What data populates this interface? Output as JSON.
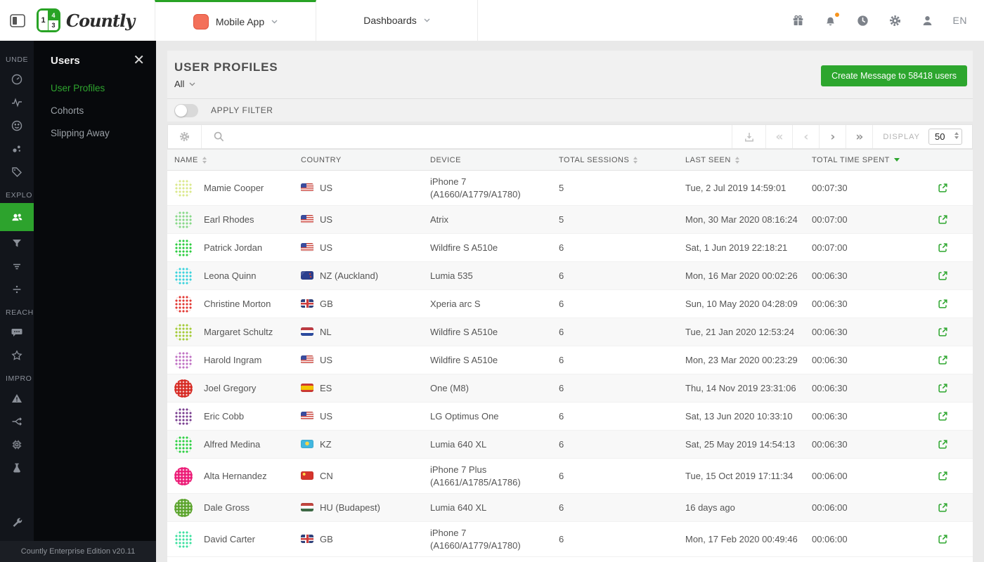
{
  "header": {
    "logo_text": "Countly",
    "app_selector_label": "Mobile App",
    "dashboards_label": "Dashboards",
    "language": "EN",
    "right_icons": [
      "gift-icon",
      "bell-icon",
      "clock-icon",
      "gear-icon",
      "user-icon"
    ],
    "bell_badge_color": "#f7941d",
    "accent_green": "#2da62e",
    "app_icon_color": "#f3705a"
  },
  "sidebar": {
    "sections": [
      {
        "label": "UNDE"
      },
      {
        "label": "EXPLO"
      },
      {
        "label": "REACH"
      },
      {
        "label": "IMPRO"
      }
    ],
    "footer": "Countly Enterprise Edition v20.11"
  },
  "flyout": {
    "title": "Users",
    "items": [
      {
        "label": "User Profiles",
        "active": true
      },
      {
        "label": "Cohorts",
        "active": false
      },
      {
        "label": "Slipping Away",
        "active": false
      }
    ]
  },
  "main": {
    "title": "USER PROFILES",
    "segment": "All",
    "create_button": "Create Message to 58418 users",
    "filter_label": "APPLY FILTER",
    "toolbar": {
      "display_label": "DISPLAY",
      "display_value": "50"
    },
    "table": {
      "columns": [
        {
          "label": "NAME",
          "sort": "both"
        },
        {
          "label": "COUNTRY",
          "sort": "none"
        },
        {
          "label": "DEVICE",
          "sort": "none"
        },
        {
          "label": "TOTAL SESSIONS",
          "sort": "both"
        },
        {
          "label": "LAST SEEN",
          "sort": "both"
        },
        {
          "label": "TOTAL TIME SPENT",
          "sort": "desc"
        }
      ],
      "rows": [
        {
          "name": "Mamie Cooper",
          "avatar": {
            "color": "#dbe98e",
            "style": "dots"
          },
          "flag": "us",
          "country": "US",
          "device": "iPhone 7 (A1660/A1779/A1780)",
          "sessions": "5",
          "last_seen": "Tue, 2 Jul 2019 14:59:01",
          "time_spent": "00:07:30"
        },
        {
          "name": "Earl Rhodes",
          "avatar": {
            "color": "#88d98a",
            "style": "dots"
          },
          "flag": "us",
          "country": "US",
          "device": "Atrix",
          "sessions": "5",
          "last_seen": "Mon, 30 Mar 2020 08:16:24",
          "time_spent": "00:07:00"
        },
        {
          "name": "Patrick Jordan",
          "avatar": {
            "color": "#2ecc40",
            "style": "dots"
          },
          "flag": "us",
          "country": "US",
          "device": "Wildfire S A510e",
          "sessions": "6",
          "last_seen": "Sat, 1 Jun 2019 22:18:21",
          "time_spent": "00:07:00"
        },
        {
          "name": "Leona Quinn",
          "avatar": {
            "color": "#3ed3dd",
            "style": "dots"
          },
          "flag": "nz",
          "country": "NZ (Auckland)",
          "device": "Lumia 535",
          "sessions": "6",
          "last_seen": "Mon, 16 Mar 2020 00:02:26",
          "time_spent": "00:06:30"
        },
        {
          "name": "Christine Morton",
          "avatar": {
            "color": "#e23a34",
            "style": "dots"
          },
          "flag": "gb",
          "country": "GB",
          "device": "Xperia arc S",
          "sessions": "6",
          "last_seen": "Sun, 10 May 2020 04:28:09",
          "time_spent": "00:06:30"
        },
        {
          "name": "Margaret Schultz",
          "avatar": {
            "color": "#a5cb39",
            "style": "dots"
          },
          "flag": "nl",
          "country": "NL",
          "device": "Wildfire S A510e",
          "sessions": "6",
          "last_seen": "Tue, 21 Jan 2020 12:53:24",
          "time_spent": "00:06:30"
        },
        {
          "name": "Harold Ingram",
          "avatar": {
            "color": "#c173c4",
            "style": "dots"
          },
          "flag": "us",
          "country": "US",
          "device": "Wildfire S A510e",
          "sessions": "6",
          "last_seen": "Mon, 23 Mar 2020 00:23:29",
          "time_spent": "00:06:30"
        },
        {
          "name": "Joel Gregory",
          "avatar": {
            "color": "#d62a23",
            "style": "solid"
          },
          "flag": "es",
          "country": "ES",
          "device": "One (M8)",
          "sessions": "6",
          "last_seen": "Thu, 14 Nov 2019 23:31:06",
          "time_spent": "00:06:30"
        },
        {
          "name": "Eric Cobb",
          "avatar": {
            "color": "#7b4090",
            "style": "dots"
          },
          "flag": "us",
          "country": "US",
          "device": "LG Optimus One",
          "sessions": "6",
          "last_seen": "Sat, 13 Jun 2020 10:33:10",
          "time_spent": "00:06:30"
        },
        {
          "name": "Alfred Medina",
          "avatar": {
            "color": "#2fd145",
            "style": "dots"
          },
          "flag": "kz",
          "country": "KZ",
          "device": "Lumia 640 XL",
          "sessions": "6",
          "last_seen": "Sat, 25 May 2019 14:54:13",
          "time_spent": "00:06:30"
        },
        {
          "name": "Alta Hernandez",
          "avatar": {
            "color": "#ec1a76",
            "style": "solid"
          },
          "flag": "cn",
          "country": "CN",
          "device": "iPhone 7 Plus (A1661/A1785/A1786)",
          "sessions": "6",
          "last_seen": "Tue, 15 Oct 2019 17:11:34",
          "time_spent": "00:06:00"
        },
        {
          "name": "Dale Gross",
          "avatar": {
            "color": "#5aa32b",
            "style": "solid"
          },
          "flag": "hu",
          "country": "HU (Budapest)",
          "device": "Lumia 640 XL",
          "sessions": "6",
          "last_seen": "16 days ago",
          "time_spent": "00:06:00"
        },
        {
          "name": "David Carter",
          "avatar": {
            "color": "#3fe0a0",
            "style": "dots"
          },
          "flag": "gb",
          "country": "GB",
          "device": "iPhone 7 (A1660/A1779/A1780)",
          "sessions": "6",
          "last_seen": "Mon, 17 Feb 2020 00:49:46",
          "time_spent": "00:06:00"
        }
      ]
    }
  }
}
